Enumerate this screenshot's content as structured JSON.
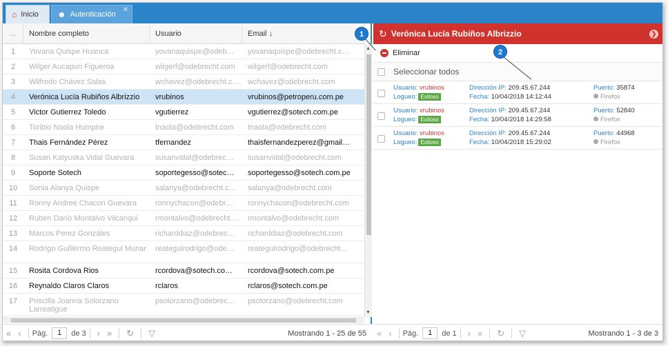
{
  "tabs": [
    {
      "label": "Inicio",
      "icon": "home-icon"
    },
    {
      "label": "Autenticación",
      "icon": "user-lock-icon"
    }
  ],
  "grid": {
    "columns": {
      "num": "...",
      "name": "Nombre completo",
      "user": "Usuario",
      "email": "Email ↓"
    },
    "rows": [
      {
        "n": "1",
        "name": "Yovana Quispe Huanca",
        "user": "yovanaquispe@odeb…",
        "email": "yovanaquispe@odebrecht.c…",
        "state": "dim"
      },
      {
        "n": "2",
        "name": "Wilger Aucapuri Figueroa",
        "user": "wilgerf@odebrecht.com",
        "email": "wilgerf@odebrecht.com",
        "state": "dim"
      },
      {
        "n": "3",
        "name": "Wilfredo Chávez Salas",
        "user": "wchavez@odebrecht.com",
        "email": "wchavez@odebrecht.com",
        "state": "dim"
      },
      {
        "n": "4",
        "name": "Verónica Lucía Rubiños Albrizzio",
        "user": "vrubinos",
        "email": "vrubinos@petroperu.com.pe",
        "state": "selected"
      },
      {
        "n": "5",
        "name": "Victor Gutierrez Toledo",
        "user": "vgutierrez",
        "email": "vgutierrez@sotech.com.pe",
        "state": "active"
      },
      {
        "n": "6",
        "name": "Toribio Naola Humpire",
        "user": "tnaola@odebrecht.com",
        "email": "tnaola@odebrecht.com",
        "state": "dim"
      },
      {
        "n": "7",
        "name": "Thais Fernández Pérez",
        "user": "tfernandez",
        "email": "thaisfernandezperez@gmail…",
        "state": "active"
      },
      {
        "n": "8",
        "name": "Susan Katyuska Vidal Guevara",
        "user": "susanvidal@odebrec…",
        "email": "susanvidal@odebrecht.com",
        "state": "dim"
      },
      {
        "n": "9",
        "name": "Soporte Sotech",
        "user": "soportegesso@sotec…",
        "email": "soportegesso@sotech.com.pe",
        "state": "active"
      },
      {
        "n": "10",
        "name": "Sonia Alanya Quispe",
        "user": "salanya@odebrecht.c…",
        "email": "salanya@odebrecht.com",
        "state": "dim"
      },
      {
        "n": "11",
        "name": "Ronny Andree Chacon Guevara",
        "user": "ronnychacon@odebr…",
        "email": "ronnychacon@odebrecht.com",
        "state": "dim"
      },
      {
        "n": "12",
        "name": "Ruben Darío Montalvo Vilcanqui",
        "user": "rmontalvo@odebrecht.com",
        "email": "rmontalvo@odebrecht.com",
        "state": "dim"
      },
      {
        "n": "13",
        "name": "Marcos Perez Gonzáles",
        "user": "richarddiaz@odebrec…",
        "email": "richarddiaz@odebrecht.com",
        "state": "dim"
      },
      {
        "n": "14",
        "name": "Rodrigo Guillermo Reategui Munar",
        "user": "reateguirodrigo@ode…",
        "email": "reateguirodrigo@odebrecht…",
        "state": "dim",
        "tall": true
      },
      {
        "n": "15",
        "name": "Rosita Cordova Rios",
        "user": "rcordova@sotech.co…",
        "email": "rcordova@sotech.com.pe",
        "state": "active"
      },
      {
        "n": "16",
        "name": "Reynaldo Claros Claros",
        "user": "rclaros",
        "email": "rclaros@sotech.com.pe",
        "state": "active"
      },
      {
        "n": "17",
        "name": "Priscilla Joanna Solorzano Larreatigue",
        "user": "psolorzano@odebrec…",
        "email": "psolorzano@odebrecht.com",
        "state": "dim",
        "tall": true
      }
    ]
  },
  "left_pager": {
    "page_label": "Pág.",
    "page": "1",
    "of_label": "de 3",
    "summary": "Mostrando 1 - 25 de 55"
  },
  "detail": {
    "title": "Verónica Lucía Rubiños Albrizzio",
    "delete_label": "Eliminar",
    "select_all_label": "Seleccionar todos",
    "sessions": [
      {
        "user_label": "Usuario:",
        "user": "vrubinos",
        "logueo_label": "Logueo:",
        "logueo": "Exitoso",
        "ip_label": "Dirección IP:",
        "ip": "209.45.67.244",
        "fecha_label": "Fecha:",
        "fecha": "10/04/2018 14:12:44",
        "puerto_label": "Puerto:",
        "puerto": "35874",
        "browser": "Firefox"
      },
      {
        "user_label": "Usuario:",
        "user": "vrubinos",
        "logueo_label": "Logueo:",
        "logueo": "Exitoso",
        "ip_label": "Dirección IP:",
        "ip": "209.45.67.244",
        "fecha_label": "Fecha:",
        "fecha": "10/04/2018 14:29:58",
        "puerto_label": "Puerto:",
        "puerto": "52840",
        "browser": "Firefox"
      },
      {
        "user_label": "Usuario:",
        "user": "vrubinos",
        "logueo_label": "Logueo:",
        "logueo": "Exitoso",
        "ip_label": "Dirección IP:",
        "ip": "209.45.67.244",
        "fecha_label": "Fecha:",
        "fecha": "10/04/2018 15:29:02",
        "puerto_label": "Puerto:",
        "puerto": "44968",
        "browser": "Firefox"
      }
    ]
  },
  "right_pager": {
    "page_label": "Pág.",
    "page": "1",
    "of_label": "de 1",
    "summary": "Mostrando 1 - 3 de 3"
  },
  "callouts": [
    "1",
    "2"
  ],
  "colors": {
    "tab_bar": "#2b83c8",
    "detail_header": "#d0332d",
    "selected_row": "#cde3f6",
    "success_badge": "#5ba844",
    "label_blue": "#2b83c8"
  }
}
